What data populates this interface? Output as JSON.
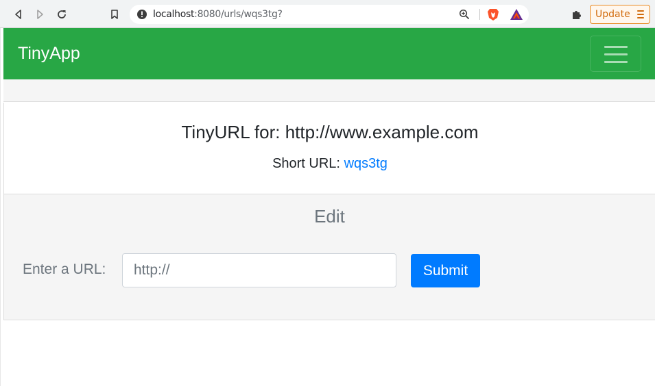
{
  "browser": {
    "url_host": "localhost",
    "url_path": ":8080/urls/wqs3tg?",
    "update_label": "Update",
    "icons": [
      "back-icon",
      "forward-icon",
      "reload-icon",
      "bookmark-icon",
      "info-icon",
      "zoom-icon",
      "brave-shield-icon",
      "brave-rewards-icon",
      "extensions-icon",
      "menu-icon"
    ]
  },
  "navbar": {
    "brand": "TinyApp",
    "color": "#28a745"
  },
  "card": {
    "title": "TinyURL for: http://www.example.com",
    "short_url_label": "Short URL:",
    "short_url_value": "wqs3tg"
  },
  "edit": {
    "heading": "Edit",
    "url_label": "Enter a URL:",
    "url_placeholder": "http://",
    "submit_label": "Submit"
  },
  "colors": {
    "primary": "#007bff",
    "success": "#28a745",
    "update_accent": "#e8871e"
  }
}
